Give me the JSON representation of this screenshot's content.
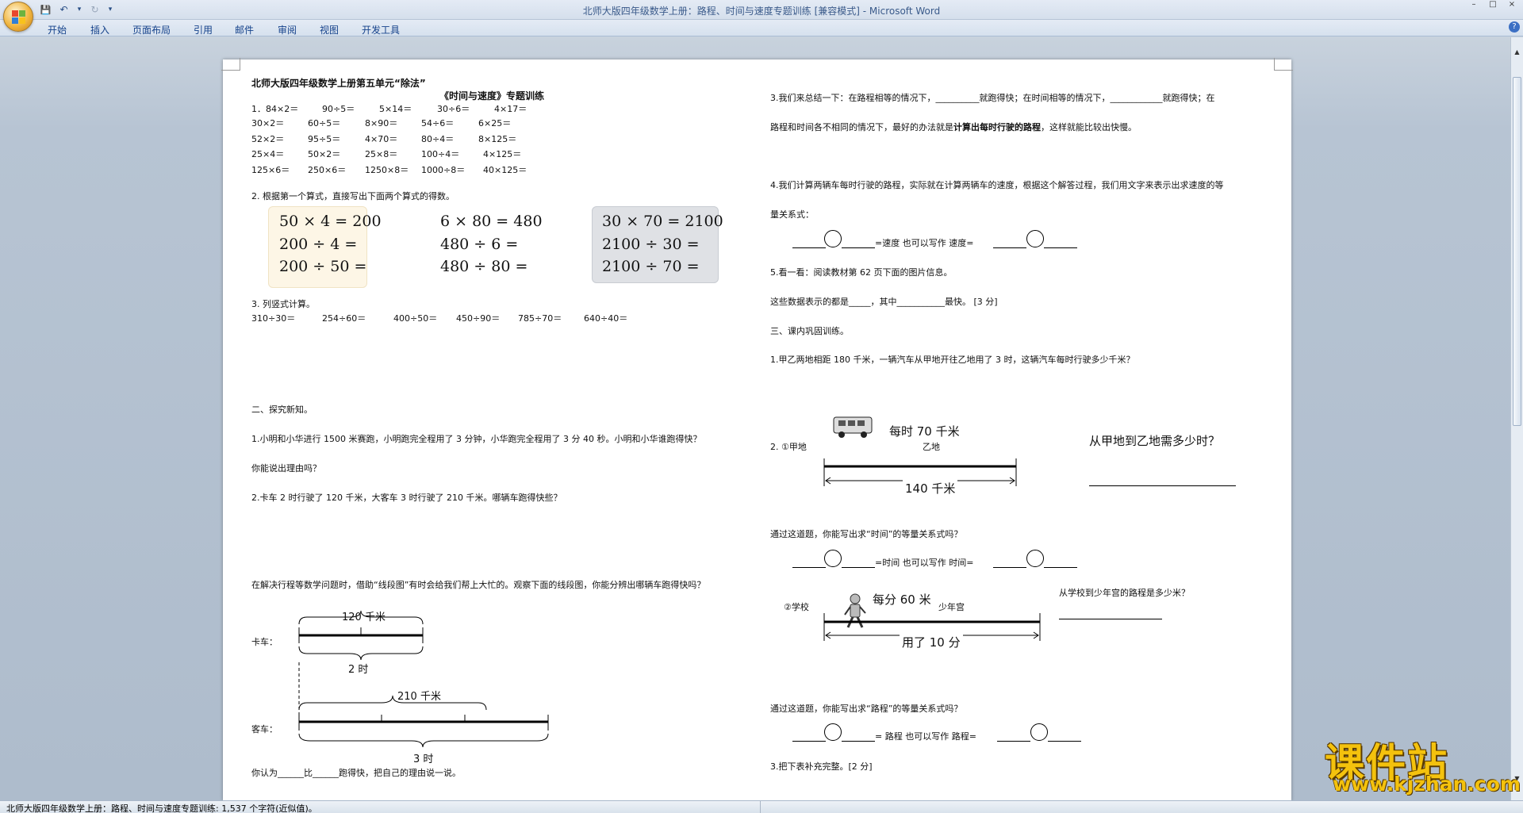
{
  "window": {
    "title": "北师大版四年级数学上册：路程、时间与速度专题训练 [兼容模式] - Microsoft Word",
    "controls": [
      "–",
      "□",
      "×"
    ]
  },
  "ribbon": {
    "tabs": [
      "开始",
      "插入",
      "页面布局",
      "引用",
      "邮件",
      "审阅",
      "视图",
      "开发工具"
    ],
    "help": "?"
  },
  "qat": {
    "save": "💾",
    "undo": "↶",
    "undo_arrow": "▾",
    "redo": "↻",
    "more": "▾"
  },
  "status": {
    "text": "北师大版四年级数学上册：路程、时间与速度专题训练: 1,537 个字符(近似值)。"
  },
  "doc": {
    "title1": "北师大版四年级数学上册第五单元“除法”",
    "title2": "《时间与速度》专题训练",
    "q1": [
      [
        "1．84×2＝",
        "90÷5＝",
        "5×14＝",
        "30÷6＝",
        "4×17＝"
      ],
      [
        "30×2＝",
        "60÷5＝",
        "8×90＝",
        "54÷6＝",
        "6×25＝"
      ],
      [
        "52×2＝",
        "95÷5＝",
        "4×70＝",
        "80÷4＝",
        "8×125＝"
      ],
      [
        "25×4＝",
        "50×2＝",
        "25×8＝",
        "100÷4＝",
        "4×125＝"
      ],
      [
        "125×6＝",
        "250×6＝",
        "1250×8＝",
        "1000÷8＝",
        "40×125＝"
      ]
    ],
    "q2": "2. 根据第一个算式，直接写出下面两个算式的得数。",
    "boxA": [
      "50 × 4 = 200",
      "200 ÷ 4 =",
      "200 ÷ 50 ="
    ],
    "boxB": [
      "6 × 80 = 480",
      "480 ÷ 6 =",
      "480 ÷ 80 ="
    ],
    "boxC": [
      "30 × 70 = 2100",
      "2100 ÷ 30 =",
      "2100 ÷ 70 ="
    ],
    "q3": "3. 列竖式计算。",
    "q3_items": [
      "310÷30＝",
      "254÷60＝",
      "400÷50＝",
      "450÷90＝",
      "785÷70＝",
      "640÷40＝"
    ],
    "sec2": "二、探究新知。",
    "p1": "1.小明和小华进行 1500 米赛跑，小明跑完全程用了 3 分钟，小华跑完全程用了 3 分 40 秒。小明和小华谁跑得快？",
    "p1b": "你能说出理由吗？",
    "p2": "2.卡车 2 时行驶了 120 千米，大客车 3 时行驶了 210 千米。哪辆车跑得快些？",
    "p3": "在解决行程等数学问题时，借助“线段图”有时会给我们帮上大忙的。观察下面的线段图，你能分辨出哪辆车跑得快吗？",
    "truck_label": "卡车：",
    "truck_dist": "120 千米",
    "truck_time": "2 时",
    "bus_label": "客车：",
    "bus_dist": "210 千米",
    "bus_time": "3 时",
    "p4": "你认为______比______跑得快，把自己的理由说一说。",
    "r1a": "3.我们来总结一下：在路程相等的情况下，__________就跑得快；在时间相等的情况下，____________就跑得快；在",
    "r1b_pre": "路程和时间各不相同的情况下，最好的办法就是",
    "r1b_bold": "计算出每时行驶的路程",
    "r1b_post": "，这样就能比较出快慢。",
    "r2a": "4.我们计算两辆车每时行驶的路程，实际就在计算两辆车的速度，根据这个解答过程，我们用文字来表示出求速度的等",
    "r2b": "量关系式：",
    "r2_formula": "=速度  也可以写作   速度=",
    "r3": "5.看一看：阅读教材第 62 页下面的图片信息。",
    "r4": "这些数据表示的都是_____，其中___________最快。     [3 分]",
    "sec3": "三、课内巩固训练。",
    "r5": "1.甲乙两地相距 180 千米，一辆汽车从甲地开往乙地用了 3 时，这辆汽车每时行驶多少千米？",
    "d1_left": "2. ①甲地",
    "d1_speed": "每时 70 千米",
    "d1_right": "乙地",
    "d1_dist": "140 千米",
    "d1_q": "从甲地到乙地需多少时？",
    "r6": "通过这道题，你能写出求“时间”的等量关系式吗？",
    "r6_formula": "=时间  也可以写作   时间=",
    "d2_left": "②学校",
    "d2_speed": "每分 60 米",
    "d2_right": "少年宫",
    "d2_time": "用了 10 分",
    "d2_q": "从学校到少年宫的路程是多少米？",
    "r7": "通过这道题，你能写出求“路程”的等量关系式吗？",
    "r7_formula": "=  路程  也可以写作   路程=",
    "r8": "3.把下表补充完整。[2 分]"
  },
  "watermark": {
    "cn": "课件站",
    "en": "www.kjzhan.com"
  }
}
